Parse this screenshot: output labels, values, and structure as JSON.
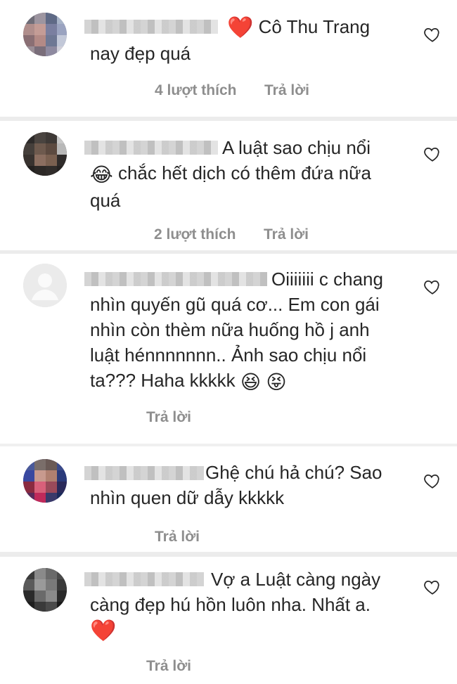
{
  "comments": [
    {
      "lead_emoji": "❤️",
      "text_line1": "Cô Thu Trang",
      "text_line2": "nay đẹp quá",
      "likes": "4 lượt thích",
      "reply": "Trả lời"
    },
    {
      "text_line1": "A luật sao chịu nổi",
      "text_line2_emoji": "😂",
      "text_line2": "chắc hết dịch có thêm đứa nữa",
      "text_line3": "quá",
      "likes": "2 lượt thích",
      "reply": "Trả lời"
    },
    {
      "text_line1": "Oiiiiiii c chang",
      "text_line2": "nhìn quyến gũ quá cơ... Em con gái",
      "text_line3": "nhìn còn thèm nữa huống hồ j anh",
      "text_line4": "luật hénnnnnnn.. Ảnh sao chịu nổi",
      "text_line5": "ta??? Haha kkkkk",
      "emoji_a": "😆",
      "emoji_b": "😝",
      "reply": "Trả lời"
    },
    {
      "text_line1": "Ghệ chú hả chú? Sao",
      "text_line2": "nhìn quen dữ dẫy kkkkk",
      "reply": "Trả lời"
    },
    {
      "text_line1": "Vợ a Luật càng ngày",
      "text_line2": "càng đẹp hú hồn luôn nha. Nhất a.",
      "trailing_emoji": "❤️",
      "reply": "Trả lời"
    }
  ],
  "icons": {
    "like": "heart-outline-icon"
  }
}
